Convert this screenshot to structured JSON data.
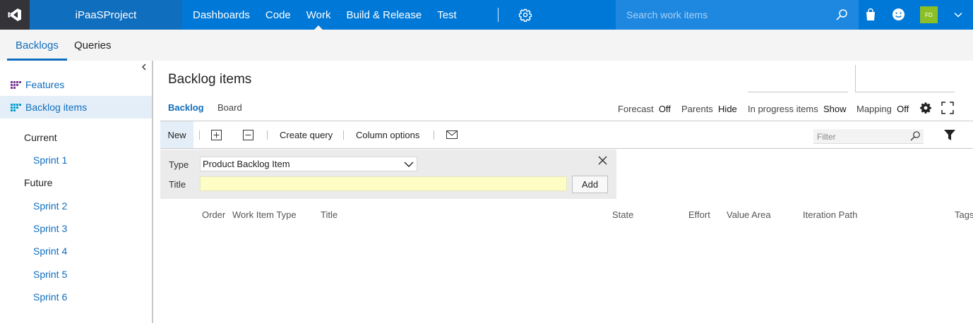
{
  "topbar": {
    "project": "iPaaSProject",
    "nav": [
      {
        "label": "Dashboards"
      },
      {
        "label": "Code"
      },
      {
        "label": "Work"
      },
      {
        "label": "Build & Release"
      },
      {
        "label": "Test"
      }
    ],
    "active_nav": "Work",
    "search_placeholder": "Search work items",
    "avatar_initials": "FD",
    "colors": {
      "bar": "#0078d7",
      "project_bg": "#106ebe",
      "logo_bg": "#333338",
      "avatar": "#8cbf26"
    }
  },
  "subnav": {
    "tabs": [
      {
        "label": "Backlogs"
      },
      {
        "label": "Queries"
      }
    ],
    "active": "Backlogs"
  },
  "sidebar": {
    "items": [
      {
        "label": "Features",
        "icon": "features-icon"
      },
      {
        "label": "Backlog items",
        "icon": "backlog-items-icon",
        "selected": true
      }
    ],
    "current_heading": "Current",
    "current_sprints": [
      "Sprint 1"
    ],
    "future_heading": "Future",
    "future_sprints": [
      "Sprint 2",
      "Sprint 3",
      "Sprint 4",
      "Sprint 5",
      "Sprint 6"
    ]
  },
  "main": {
    "title": "Backlog items",
    "view_tabs": [
      {
        "label": "Backlog"
      },
      {
        "label": "Board"
      }
    ],
    "active_view": "Backlog",
    "pivots": [
      {
        "label": "Forecast",
        "value": "Off"
      },
      {
        "label": "Parents",
        "value": "Hide"
      },
      {
        "label": "In progress items",
        "value": "Show"
      },
      {
        "label": "Mapping",
        "value": "Off"
      }
    ]
  },
  "toolbar": {
    "new_label": "New",
    "expand_icon": "expand-all-icon",
    "collapse_icon": "collapse-all-icon",
    "create_query_label": "Create query",
    "column_options_label": "Column options",
    "email_icon": "mail-icon",
    "filter_placeholder": "Filter"
  },
  "add_panel": {
    "type_label": "Type",
    "type_value": "Product Backlog Item",
    "title_label": "Title",
    "title_value": "",
    "add_label": "Add"
  },
  "grid": {
    "columns": [
      "Order",
      "Work Item Type",
      "Title",
      "State",
      "Effort",
      "Value Area",
      "Iteration Path",
      "Tags"
    ]
  }
}
